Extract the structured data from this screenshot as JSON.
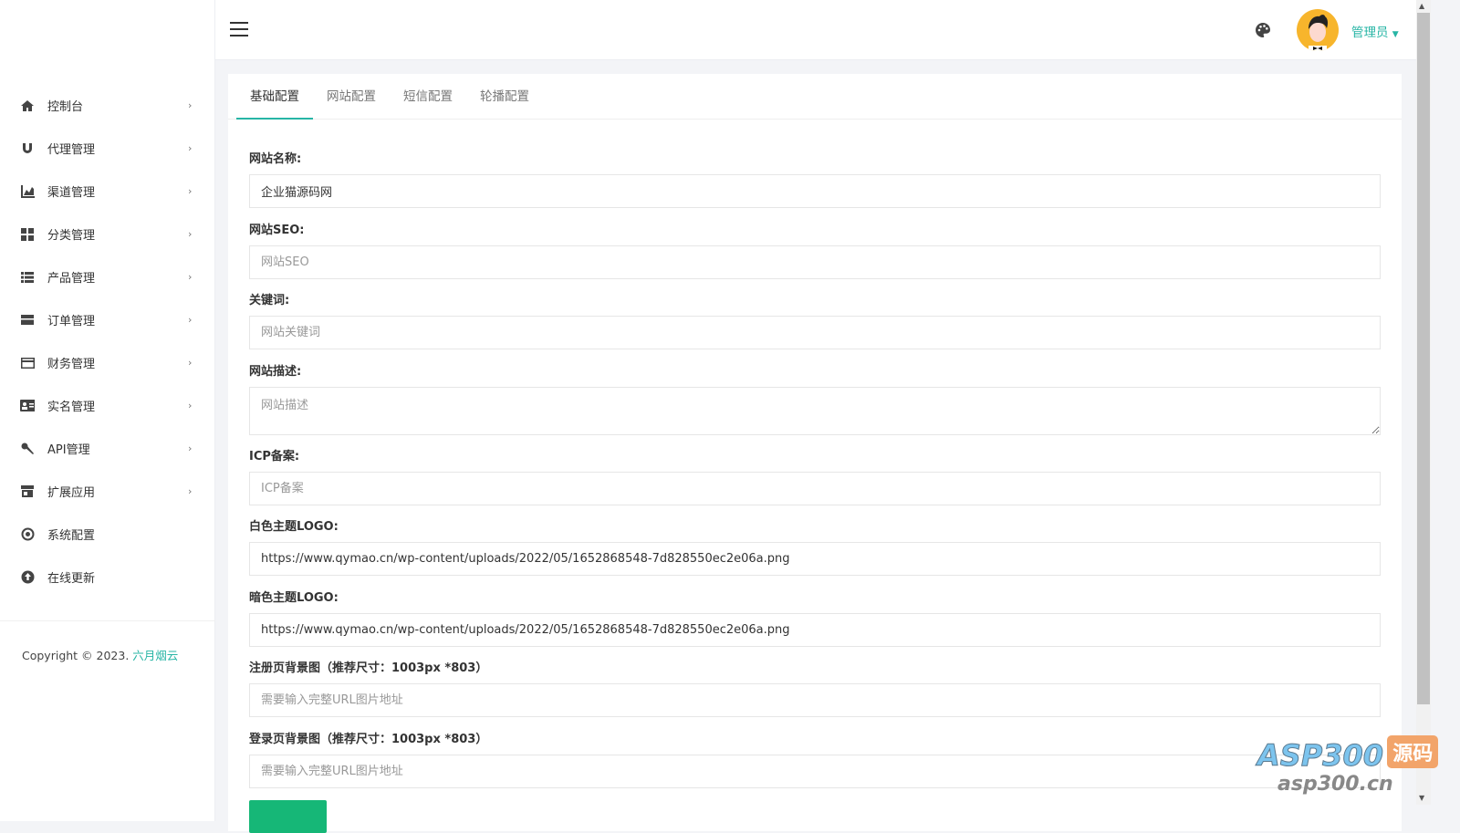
{
  "sidebar": {
    "items": [
      {
        "label": "控制台",
        "icon": "home-icon",
        "chev": "›"
      },
      {
        "label": "代理管理",
        "icon": "magnet-icon",
        "chev": "›"
      },
      {
        "label": "渠道管理",
        "icon": "chart-area-icon",
        "chev": "›"
      },
      {
        "label": "分类管理",
        "icon": "grid-icon",
        "chev": "›"
      },
      {
        "label": "产品管理",
        "icon": "list-icon",
        "chev": "›"
      },
      {
        "label": "订单管理",
        "icon": "order-icon",
        "chev": "›"
      },
      {
        "label": "财务管理",
        "icon": "credit-card-icon",
        "chev": "›"
      },
      {
        "label": "实名管理",
        "icon": "id-card-icon",
        "chev": "›"
      },
      {
        "label": "API管理",
        "icon": "wrench-icon",
        "chev": "›"
      },
      {
        "label": "扩展应用",
        "icon": "store-icon",
        "chev": "›"
      },
      {
        "label": "系统配置",
        "icon": "settings-icon"
      },
      {
        "label": "在线更新",
        "icon": "upload-icon"
      }
    ],
    "copyright": "Copyright © 2023.",
    "copyright_link": "六月烟云"
  },
  "header": {
    "user": "管理员"
  },
  "tabs": [
    "基础配置",
    "网站配置",
    "短信配置",
    "轮播配置"
  ],
  "form": {
    "site_name": {
      "label": "网站名称:",
      "value": "企业猫源码网"
    },
    "seo": {
      "label": "网站SEO:",
      "placeholder": "网站SEO"
    },
    "keywords": {
      "label": "关键词:",
      "placeholder": "网站关键词"
    },
    "desc": {
      "label": "网站描述:",
      "placeholder": "网站描述"
    },
    "icp": {
      "label": "ICP备案:",
      "placeholder": "ICP备案"
    },
    "logo_light": {
      "label": "白色主题LOGO:",
      "value": "https://www.qymao.cn/wp-content/uploads/2022/05/1652868548-7d828550ec2e06a.png"
    },
    "logo_dark": {
      "label": "暗色主题LOGO:",
      "value": "https://www.qymao.cn/wp-content/uploads/2022/05/1652868548-7d828550ec2e06a.png"
    },
    "reg_bg": {
      "label": "注册页背景图（推荐尺寸：1003px *803）",
      "placeholder": "需要输入完整URL图片地址"
    },
    "login_bg": {
      "label": "登录页背景图（推荐尺寸：1003px *803）",
      "placeholder": "需要输入完整URL图片地址"
    }
  },
  "watermark": {
    "brand": "ASP300",
    "tag": "源码",
    "url": "asp300.cn"
  }
}
